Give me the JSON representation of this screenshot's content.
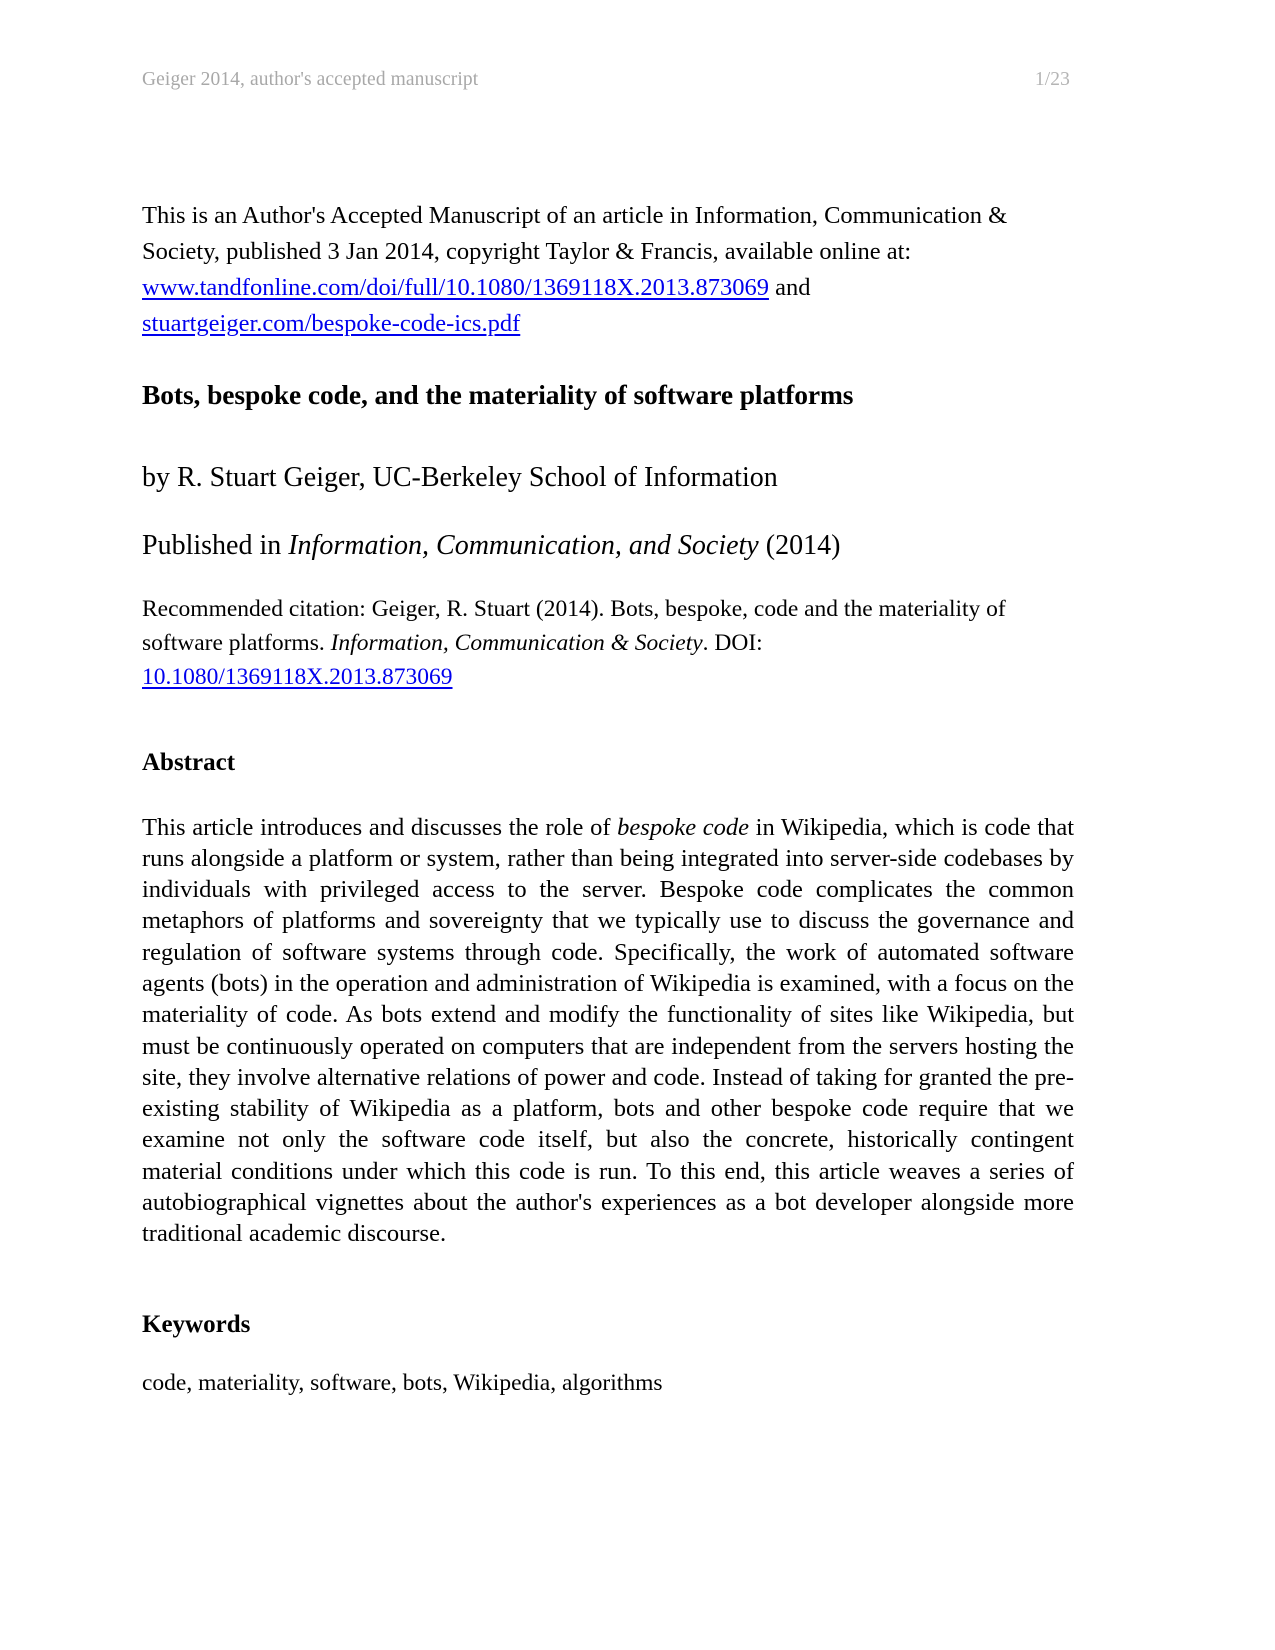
{
  "header": {
    "left_text": "Geiger 2014, author's accepted manuscript",
    "page_indicator": "1/23",
    "color": "#a8a8a8"
  },
  "intro": {
    "part1": "This is an Author's Accepted Manuscript of an article in Information, Communication & Society, published 3 Jan 2014, copyright Taylor & Francis, available online at: ",
    "link1": "www.tandfonline.com/doi/full/10.1080/1369118X.2013.873069",
    "joiner": " and ",
    "link2": "stuartgeiger.com/bespoke-code-ics.pdf"
  },
  "title": "Bots, bespoke code, and the materiality of software platforms",
  "byline": "by R. Stuart Geiger, UC-Berkeley School of Information",
  "published_in": {
    "prefix": "Published in ",
    "journal": "Information, Communication, and Society",
    "suffix": " (2014)"
  },
  "citation": {
    "part1": "Recommended citation: Geiger, R. Stuart (2014). Bots, bespoke, code and the materiality of software platforms. ",
    "journal": "Information, Communication & Society",
    "part2": ". DOI: ",
    "doi": "10.1080/1369118X.2013.873069"
  },
  "abstract": {
    "heading": "Abstract",
    "part1": "This article introduces and discusses the role of ",
    "emphasis": "bespoke code",
    "part2": " in Wikipedia, which is code that runs alongside a platform or system, rather than being integrated into server-side codebases by individuals with privileged access to the server. Bespoke code complicates the common metaphors of platforms and sovereignty that we typically use to discuss the governance and regulation of software systems through code. Specifically, the work of automated software agents (bots) in the operation and administration of Wikipedia is examined, with a focus on the materiality of code. As bots extend and modify the functionality of sites like Wikipedia, but must be continuously operated on computers that are independent from the servers hosting the site, they involve alternative relations of power and code. Instead of taking for granted the pre-existing stability of Wikipedia as a platform, bots and other bespoke code require that we examine not only the software code itself, but also the concrete, historically contingent material conditions under which this code is run. To this end, this article weaves a series of autobiographical vignettes about the author's experiences as a bot developer alongside more traditional academic discourse."
  },
  "keywords": {
    "heading": "Keywords",
    "list": "code, materiality, software, bots, Wikipedia, algorithms"
  }
}
